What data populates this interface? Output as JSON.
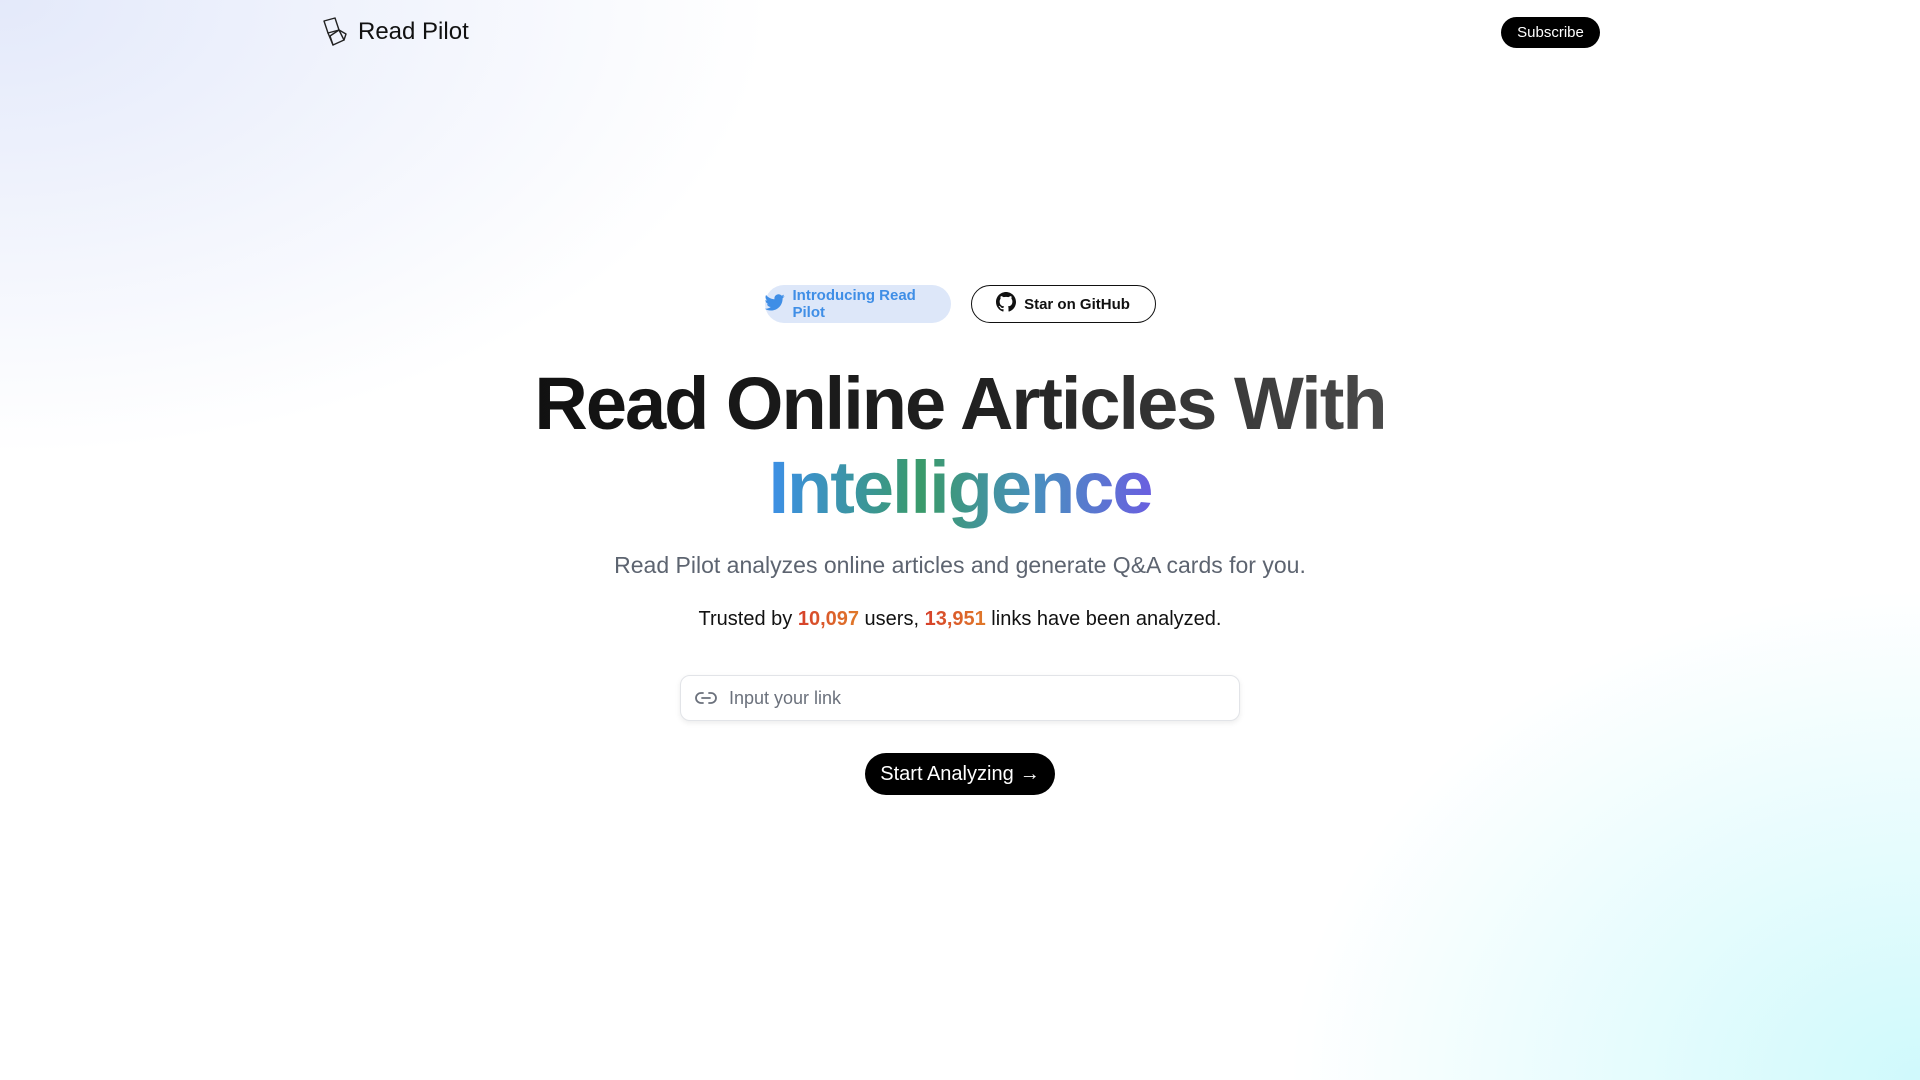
{
  "header": {
    "brand_name": "Read Pilot",
    "subscribe_label": "Subscribe"
  },
  "badges": {
    "twitter": {
      "label": "Introducing Read Pilot",
      "icon": "twitter-bird-icon",
      "color": "#3f8ee6"
    },
    "github": {
      "label": "Star on GitHub",
      "icon": "github-icon"
    }
  },
  "hero": {
    "headline_line1": "Read Online Articles With",
    "headline_line2": "Intelligence",
    "subtitle": "Read Pilot analyzes online articles and generate Q&A cards for you.",
    "trusted_prefix": "Trusted by ",
    "users_count": "10,097",
    "users_suffix": " users, ",
    "links_count": "13,951",
    "links_suffix": " links have been analyzed."
  },
  "link_input": {
    "placeholder": "Input your link",
    "value": "",
    "icon": "link-icon"
  },
  "cta": {
    "label": "Start Analyzing",
    "arrow": "→"
  },
  "colors": {
    "accent_number": "#d6402a",
    "button_bg": "#000000",
    "twitter_pill_bg": "#dde7f9"
  }
}
